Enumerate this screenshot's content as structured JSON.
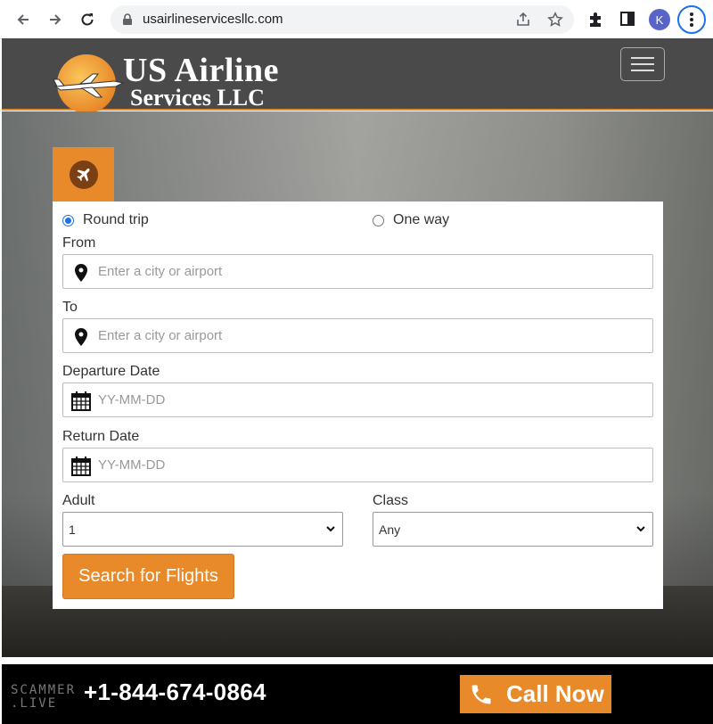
{
  "browser": {
    "url": "usairlineservicesllc.com",
    "profile_initial": "K"
  },
  "site": {
    "logo_line1": "US Airline",
    "logo_line2": "Services LLC"
  },
  "form": {
    "trip_types": [
      {
        "label": "Round trip",
        "selected": true
      },
      {
        "label": "One way",
        "selected": false
      }
    ],
    "from_label": "From",
    "from_placeholder": "Enter a city or airport",
    "to_label": "To",
    "to_placeholder": "Enter a city or airport",
    "departure_label": "Departure Date",
    "departure_placeholder": "YY-MM-DD",
    "return_label": "Return Date",
    "return_placeholder": "YY-MM-DD",
    "adult_label": "Adult",
    "adult_value": "1",
    "class_label": "Class",
    "class_value": "Any",
    "search_button": "Search for Flights"
  },
  "footer": {
    "watermark_line1": "SCAMMER",
    "watermark_line2": ".LIVE",
    "phone": "+1-844-674-0864",
    "call_button": "Call Now"
  },
  "colors": {
    "accent": "#e8892a",
    "header_bg": "#4a4a4a",
    "link_blue": "#1a73e8"
  },
  "icons": [
    "back-arrow-icon",
    "forward-arrow-icon",
    "reload-icon",
    "lock-icon",
    "share-icon",
    "star-icon",
    "extensions-icon",
    "side-panel-icon",
    "kebab-menu-icon",
    "plane-icon",
    "map-pin-icon",
    "calendar-icon",
    "chevron-down-icon",
    "phone-icon"
  ]
}
